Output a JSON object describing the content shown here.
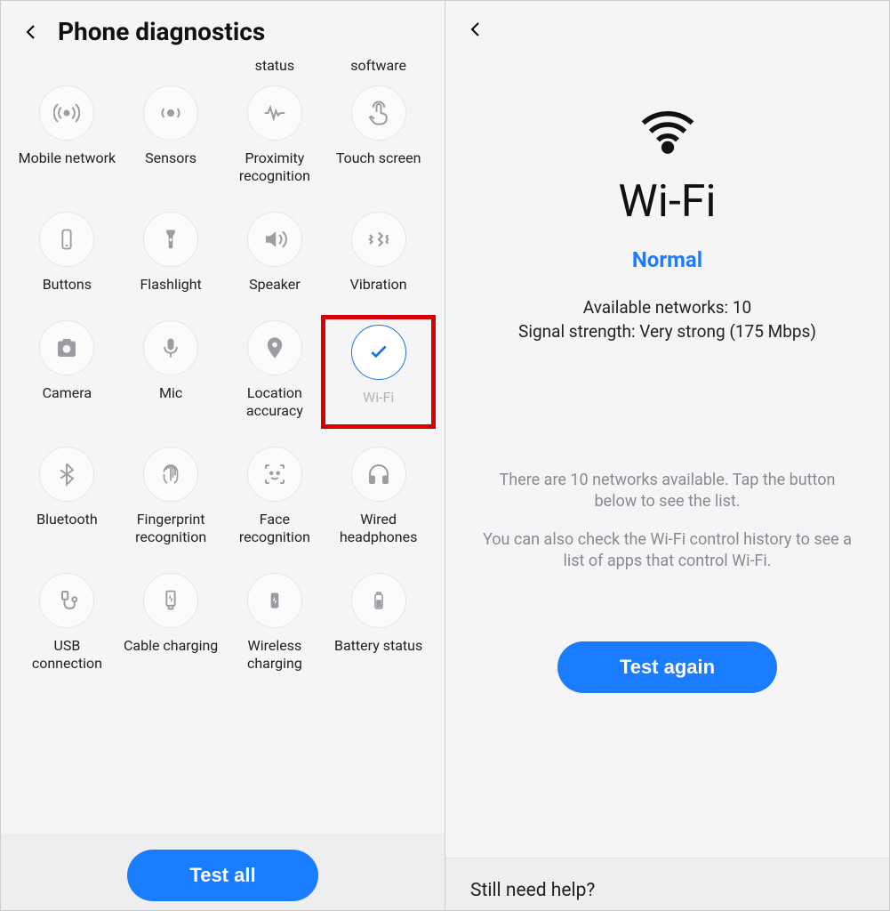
{
  "left": {
    "title": "Phone diagnostics",
    "partial_row": [
      "",
      "",
      "status",
      "software"
    ],
    "items": [
      {
        "id": "mobile-network",
        "label": "Mobile network",
        "icon": "antenna"
      },
      {
        "id": "sensors",
        "label": "Sensors",
        "icon": "sensors"
      },
      {
        "id": "proximity",
        "label": "Proximity recognition",
        "icon": "pulse"
      },
      {
        "id": "touch",
        "label": "Touch screen",
        "icon": "touch"
      },
      {
        "id": "buttons",
        "label": "Buttons",
        "icon": "phone-button"
      },
      {
        "id": "flashlight",
        "label": "Flashlight",
        "icon": "flashlight"
      },
      {
        "id": "speaker",
        "label": "Speaker",
        "icon": "speaker"
      },
      {
        "id": "vibration",
        "label": "Vibration",
        "icon": "vibration"
      },
      {
        "id": "camera",
        "label": "Camera",
        "icon": "camera"
      },
      {
        "id": "mic",
        "label": "Mic",
        "icon": "mic"
      },
      {
        "id": "location",
        "label": "Location accuracy",
        "icon": "location"
      },
      {
        "id": "wifi",
        "label": "Wi-Fi",
        "icon": "check",
        "checked": true,
        "highlight": true
      },
      {
        "id": "bluetooth",
        "label": "Bluetooth",
        "icon": "bluetooth"
      },
      {
        "id": "fingerprint",
        "label": "Fingerprint recognition",
        "icon": "fingerprint"
      },
      {
        "id": "face",
        "label": "Face recognition",
        "icon": "face"
      },
      {
        "id": "wired-headphones",
        "label": "Wired headphones",
        "icon": "headphones"
      },
      {
        "id": "usb",
        "label": "USB connection",
        "icon": "usb"
      },
      {
        "id": "cable-charging",
        "label": "Cable charging",
        "icon": "cable-charge"
      },
      {
        "id": "wireless-charging",
        "label": "Wireless charging",
        "icon": "wireless-charge"
      },
      {
        "id": "battery",
        "label": "Battery status",
        "icon": "battery"
      }
    ],
    "button": "Test all"
  },
  "right": {
    "title": "Wi-Fi",
    "status": "Normal",
    "line1": "Available networks: 10",
    "line2": "Signal strength: Very strong (175 Mbps)",
    "help1": "There are 10 networks available. Tap the button below to see the list.",
    "help2": "You can also check the Wi-Fi control history to see a list of apps that control Wi-Fi.",
    "button": "Test again",
    "footer": "Still need help?"
  },
  "icons": {
    "antenna": "<svg width='30' height='30' viewBox='0 0 24 24' fill='none' stroke='currentColor' stroke-width='1.6'><circle cx='12' cy='12' r='2' fill='currentColor'/><path d='M7 7a7 7 0 0 0 0 10M17 7a7 7 0 0 1 0 10M4 4a11 11 0 0 0 0 16M20 4a11 11 0 0 1 0 16'/></svg>",
    "sensors": "<svg width='30' height='30' viewBox='0 0 24 24' fill='none' stroke='currentColor' stroke-width='1.6'><circle cx='12' cy='12' r='2.5' fill='currentColor'/><path d='M6 8a6 6 0 0 0 0 8M18 8a6 6 0 0 1 0 8'/></svg>",
    "pulse": "<svg width='30' height='30' viewBox='0 0 24 24' fill='none' stroke='currentColor' stroke-width='1.6'><path d='M3 12h3l2-5 3 10 2-7 2 4 2-2h4'/></svg>",
    "touch": "<svg width='30' height='30' viewBox='0 0 24 24' fill='none' stroke='currentColor' stroke-width='1.6'><path d='M10 11V6a2 2 0 1 1 4 0v6l3 1a3 3 0 0 1 2 3v1a5 5 0 0 1-5 5h-3a5 5 0 0 1-4-2l-3-4 1-1 3 2'/><path d='M7 7a5 5 0 0 1 10 0' stroke-dasharray='0'/></svg>",
    "phone-button": "<svg width='28' height='28' viewBox='0 0 24 24' fill='none' stroke='currentColor' stroke-width='1.6'><rect x='8' y='3' width='8' height='18' rx='2'/><line x1='11' y1='18' x2='13' y2='18'/></svg>",
    "flashlight": "<svg width='28' height='28' viewBox='0 0 24 24' fill='currentColor'><path d='M8 3h8v3l-2 3v10a2 2 0 0 1-4 0V9L8 6z'/><rect x='11' y='11' width='2' height='3' fill='#f5f5f7'/></svg>",
    "speaker": "<svg width='30' height='30' viewBox='0 0 24 24' fill='none' stroke='currentColor' stroke-width='1.6'><path d='M4 9v6h4l5 4V5L8 9H4z' fill='currentColor' stroke='none'/><path d='M16 8a5 5 0 0 1 0 8M19 5a9 9 0 0 1 0 14'/></svg>",
    "vibration": "<svg width='30' height='30' viewBox='0 0 24 24' fill='none' stroke='currentColor' stroke-width='1.8'><path d='M4 8l2 2-2 2 2 2-2 2M12 6l3 3-3 3 3 3-3 3M20 8l-1 2 1 2-1 2 1 2'/></svg>",
    "camera": "<svg width='30' height='30' viewBox='0 0 24 24' fill='currentColor'><path d='M4 8a2 2 0 0 1 2-2h2l1-2h6l1 2h2a2 2 0 0 1 2 2v10a2 2 0 0 1-2 2H6a2 2 0 0 1-2-2z'/><circle cx='12' cy='13' r='3.5' fill='#f5f5f7'/></svg>",
    "mic": "<svg width='28' height='28' viewBox='0 0 24 24' fill='currentColor'><rect x='9' y='3' width='6' height='11' rx='3'/><path d='M6 11a6 6 0 0 0 12 0M12 17v4' stroke='currentColor' stroke-width='1.6' fill='none'/></svg>",
    "location": "<svg width='28' height='28' viewBox='0 0 24 24' fill='currentColor'><path d='M12 2a7 7 0 0 1 7 7c0 5-7 13-7 13S5 14 5 9a7 7 0 0 1 7-7z'/><circle cx='12' cy='9' r='2.5' fill='#f5f5f7'/></svg>",
    "check": "<svg width='26' height='26' viewBox='0 0 24 24' fill='none' stroke='currentColor' stroke-width='2.5'><path d='M5 12l4 4 10-10'/></svg>",
    "bluetooth": "<svg width='28' height='28' viewBox='0 0 24 24' fill='none' stroke='currentColor' stroke-width='1.6'><path d='M12 2v20l6-6-12-8m0 8l12-8-6-6'/></svg>",
    "fingerprint": "<svg width='30' height='30' viewBox='0 0 24 24' fill='none' stroke='currentColor' stroke-width='1.4'><path d='M6 10a6 6 0 0 1 12 0v2M8 8a4 4 0 0 1 8 0v5M10 7a2 2 0 0 1 4 0v8M12 6v12M6 12v3a6 6 0 0 0 3 5M18 12v3a6 6 0 0 1-3 5'/></svg>",
    "face": "<svg width='30' height='30' viewBox='0 0 24 24' fill='none' stroke='currentColor' stroke-width='1.6'><path d='M4 7V5a1 1 0 0 1 1-1h2M20 7V5a1 1 0 0 0-1-1h-2M4 17v2a1 1 0 0 0 1 1h2M20 17v2a1 1 0 0 1-1 1h-2'/><circle cx='9' cy='11' r='1' fill='currentColor'/><circle cx='15' cy='11' r='1' fill='currentColor'/><path d='M9 15a4 4 0 0 0 6 0'/></svg>",
    "headphones": "<svg width='30' height='30' viewBox='0 0 24 24' fill='none' stroke='currentColor' stroke-width='1.6'><path d='M4 14v-2a8 8 0 0 1 16 0v2'/><rect x='4' y='14' width='4' height='6' rx='1' fill='currentColor'/><rect x='16' y='14' width='4' height='6' rx='1' fill='currentColor'/></svg>",
    "usb": "<svg width='30' height='30' viewBox='0 0 24 24' fill='none' stroke='currentColor' stroke-width='1.6'><rect x='8' y='4' width='5' height='7' rx='1'/><path d='M10 11v4a4 4 0 0 0 4 4h2a3 3 0 0 0 3-3v-3'/><circle cx='19' cy='11' r='2'/></svg>",
    "cable-charge": "<svg width='28' height='28' viewBox='0 0 24 24' fill='none' stroke='currentColor' stroke-width='1.6'><rect x='8' y='3' width='8' height='14' rx='1'/><path d='M10 17v3h4v-3'/><path d='M12 6l-2 4h4l-2 4' fill='currentColor' stroke='none'/></svg>",
    "wireless-charge": "<svg width='26' height='26' viewBox='0 0 24 24' fill='currentColor'><rect x='8' y='4' width='8' height='16' rx='2'/><path d='M12 8l-2 4h4l-2 4' fill='#f5f5f7'/></svg>",
    "battery": "<svg width='24' height='28' viewBox='0 0 24 24' fill='none' stroke='currentColor' stroke-width='1.6'><rect x='8' y='5' width='8' height='16' rx='2'/><rect x='10' y='3' width='4' height='2'/><rect x='10' y='12' width='4' height='7' fill='currentColor'/></svg>",
    "wifi-big": "<svg width='70' height='55' viewBox='0 0 24 20' fill='none' stroke='currentColor' stroke-width='2'><path d='M2 7a15 15 0 0 1 20 0M5 10.5a10 10 0 0 1 14 0M8 14a5.5 5.5 0 0 1 8 0'/><circle cx='12' cy='17' r='1.6' fill='currentColor'/></svg>",
    "chevron-left": "<svg width='24' height='24' viewBox='0 0 24 24' fill='none' stroke='currentColor' stroke-width='2'><path d='M15 5l-7 7 7 7'/></svg>"
  }
}
